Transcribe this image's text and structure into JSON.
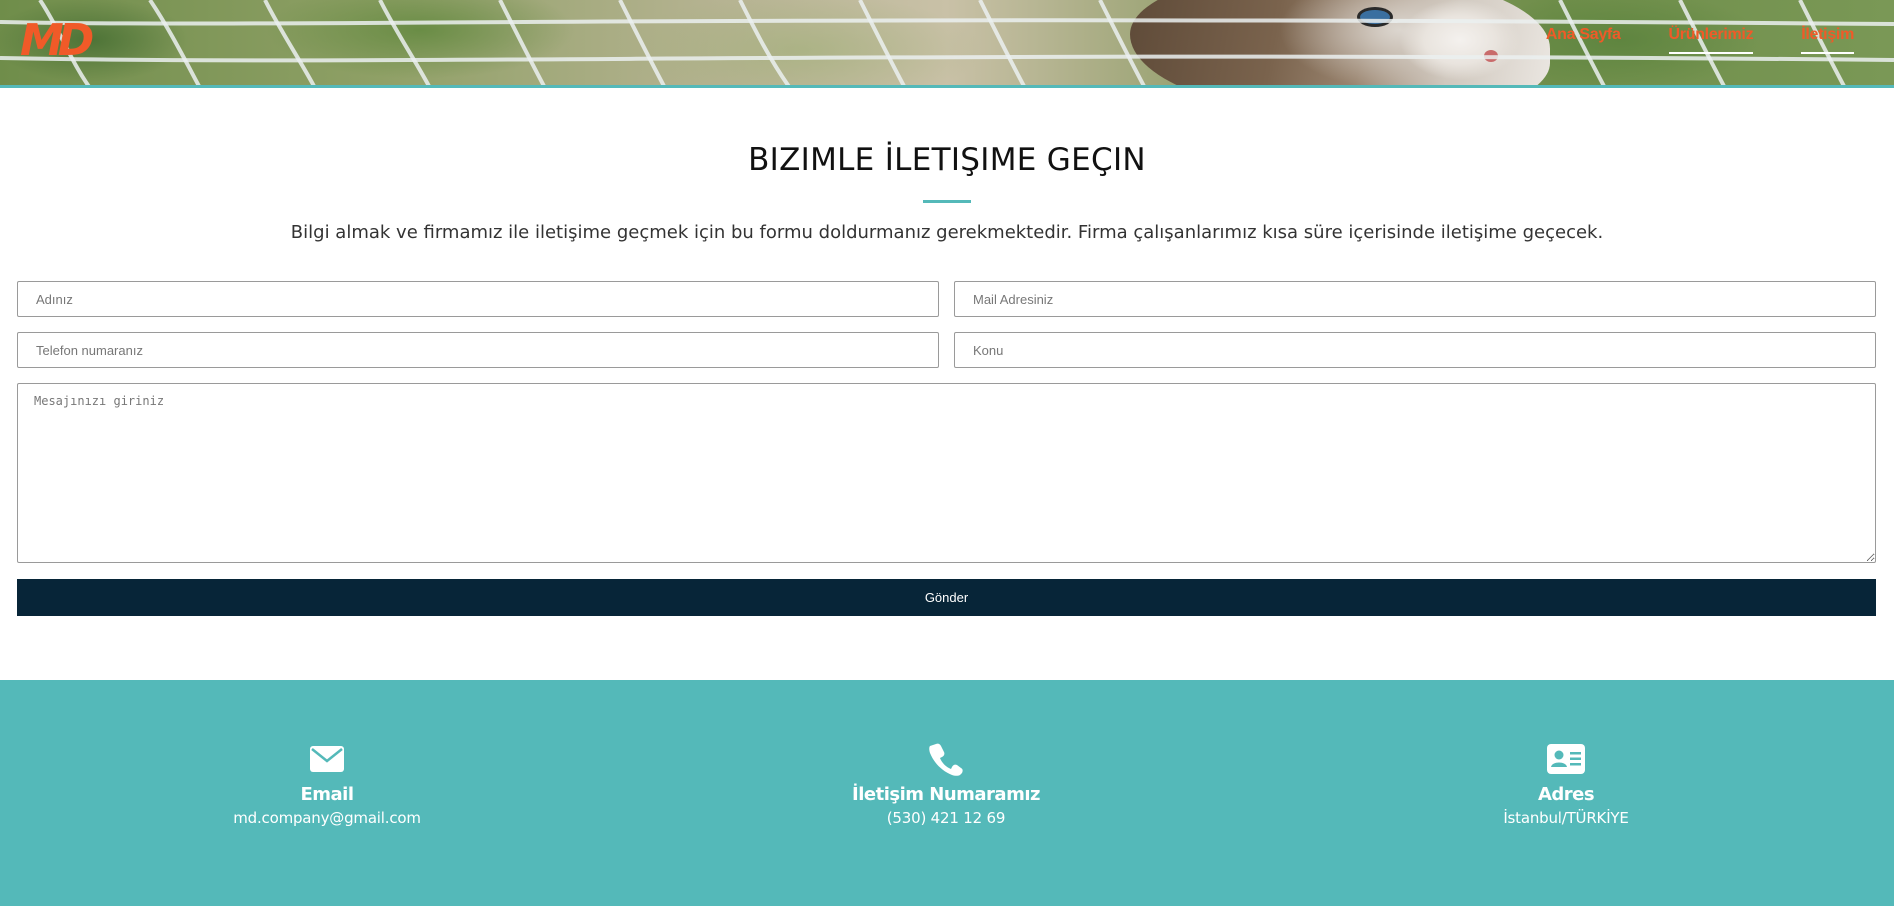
{
  "brand": {
    "logo_text": "MD",
    "accent": "#f05a28",
    "teal": "#54b9b9",
    "navy": "#072538"
  },
  "nav": {
    "items": [
      {
        "label": "Ana Sayfa",
        "active": false
      },
      {
        "label": "Ürünlerimiz",
        "active": true
      },
      {
        "label": "İletişim",
        "active": true
      }
    ]
  },
  "contact": {
    "title": "BIZIMLE İLETIŞIME GEÇIN",
    "intro": "Bilgi almak ve firmamız ile iletişime geçmek için bu formu doldurmanız gerekmektedir. Firma çalışanlarımız kısa süre içerisinde iletişime geçecek."
  },
  "form": {
    "name_placeholder": "Adınız",
    "mail_placeholder": "Mail Adresiniz",
    "phone_placeholder": "Telefon numaranız",
    "subject_placeholder": "Konu",
    "message_placeholder": "Mesajınızı giriniz",
    "submit_label": "Gönder"
  },
  "info": {
    "email": {
      "icon": "envelope-icon",
      "title": "Email",
      "value": "md.company@gmail.com"
    },
    "phone": {
      "icon": "phone-icon",
      "title": "İletişim Numaramız",
      "value": "(530) 421 12 69"
    },
    "address": {
      "icon": "address-card-icon",
      "title": "Adres",
      "value": "İstanbul/TÜRKİYE"
    }
  }
}
